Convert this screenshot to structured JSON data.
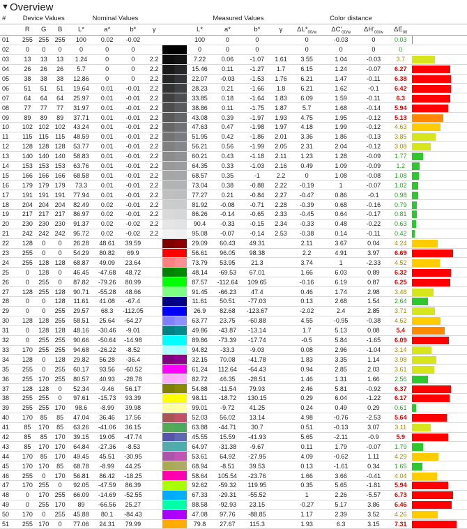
{
  "section_title": "Overview",
  "header1": {
    "num": "#",
    "device": "Device Values",
    "nominal": "Nominal Values",
    "measured": "Measured Values",
    "colordist": "Color distance"
  },
  "header2": [
    "R",
    "G",
    "B",
    "L*",
    "a*",
    "b*",
    "γ",
    "",
    "L*",
    "a*",
    "b*",
    "γ",
    "ΔL*00/w",
    "ΔC'00/w",
    "ΔH'00/w",
    "ΔE00",
    ""
  ],
  "rows": [
    {
      "n": "01",
      "r": 255,
      "g": 255,
      "b": 255,
      "nl": "100",
      "na": "0.02",
      "nb": "-0.02",
      "ng": "",
      "ml": "100",
      "ma": "0",
      "mb": "0",
      "mg": "",
      "dl": "0",
      "dc": "-0.03",
      "dh": "0",
      "de": "0.03",
      "nom": "#ffffff",
      "meas": "#ffffff"
    },
    {
      "n": "02",
      "r": 0,
      "g": 0,
      "b": 0,
      "nl": "0",
      "na": "0",
      "nb": "0",
      "ng": "",
      "ml": "0",
      "ma": "0",
      "mb": "0",
      "mg": "",
      "dl": "0",
      "dc": "0",
      "dh": "0",
      "de": "0",
      "nom": "#000000",
      "meas": "#000000"
    },
    {
      "n": "03",
      "r": 13,
      "g": 13,
      "b": 13,
      "nl": "1.24",
      "na": "0",
      "nb": "0",
      "ng": "2.2",
      "ml": "7.22",
      "ma": "0.06",
      "mb": "-1.07",
      "mg": "1.61",
      "dl": "3.55",
      "dc": "1.04",
      "dh": "-0.03",
      "de": "3.7",
      "nom": "#0d0d0d",
      "meas": "#131314"
    },
    {
      "n": "04",
      "r": 26,
      "g": 26,
      "b": 26,
      "nl": "5.7",
      "na": "0",
      "nb": "0",
      "ng": "2.2",
      "ml": "15.46",
      "ma": "0.11",
      "mb": "-1.27",
      "mg": "1.7",
      "dl": "6.15",
      "dc": "1.24",
      "dh": "-0.07",
      "de": "6.27",
      "nom": "#1a1a1a",
      "meas": "#262628"
    },
    {
      "n": "05",
      "r": 38,
      "g": 38,
      "b": 38,
      "nl": "12.86",
      "na": "0",
      "nb": "0",
      "ng": "2.2",
      "ml": "22.07",
      "ma": "-0.03",
      "mb": "-1.53",
      "mg": "1.76",
      "dl": "6.21",
      "dc": "1.47",
      "dh": "-0.11",
      "de": "6.38",
      "nom": "#262626",
      "meas": "#333437"
    },
    {
      "n": "06",
      "r": 51,
      "g": 51,
      "b": 51,
      "nl": "19.64",
      "na": "0.01",
      "nb": "-0.01",
      "ng": "2.2",
      "ml": "28.23",
      "ma": "0.21",
      "mb": "-1.66",
      "mg": "1.8",
      "dl": "6.21",
      "dc": "1.62",
      "dh": "-0.1",
      "de": "6.42",
      "nom": "#333333",
      "meas": "#404145"
    },
    {
      "n": "07",
      "r": 64,
      "g": 64,
      "b": 64,
      "nl": "25.97",
      "na": "0.01",
      "nb": "-0.01",
      "ng": "2.2",
      "ml": "33.85",
      "ma": "0.18",
      "mb": "-1.64",
      "mg": "1.83",
      "dl": "6.09",
      "dc": "1.59",
      "dh": "-0.11",
      "de": "6.3",
      "nom": "#404040",
      "meas": "#4d4e52"
    },
    {
      "n": "08",
      "r": 77,
      "g": 77,
      "b": 77,
      "nl": "31.97",
      "na": "0.01",
      "nb": "-0.01",
      "ng": "2.2",
      "ml": "38.86",
      "ma": "0.11",
      "mb": "-1.75",
      "mg": "1.87",
      "dl": "5.7",
      "dc": "1.68",
      "dh": "-0.14",
      "de": "5.94",
      "nom": "#4d4d4d",
      "meas": "#5a5b5f"
    },
    {
      "n": "09",
      "r": 89,
      "g": 89,
      "b": 89,
      "nl": "37.71",
      "na": "0.01",
      "nb": "-0.01",
      "ng": "2.2",
      "ml": "43.08",
      "ma": "0.39",
      "mb": "-1.97",
      "mg": "1.93",
      "dl": "4.75",
      "dc": "1.95",
      "dh": "-0.12",
      "de": "5.13",
      "nom": "#595959",
      "meas": "#65666b"
    },
    {
      "n": "10",
      "r": 102,
      "g": 102,
      "b": 102,
      "nl": "43.24",
      "na": "0.01",
      "nb": "-0.01",
      "ng": "2.2",
      "ml": "47.63",
      "ma": "0.47",
      "mb": "-1.98",
      "mg": "1.97",
      "dl": "4.18",
      "dc": "1.99",
      "dh": "-0.12",
      "de": "4.63",
      "nom": "#666666",
      "meas": "#717277"
    },
    {
      "n": "11",
      "r": 115,
      "g": 115,
      "b": 115,
      "nl": "48.59",
      "na": "0.01",
      "nb": "-0.01",
      "ng": "2.2",
      "ml": "51.95",
      "ma": "0.42",
      "mb": "-1.86",
      "mg": "2.01",
      "dl": "3.36",
      "dc": "1.86",
      "dh": "-0.13",
      "de": "3.85",
      "nom": "#737373",
      "meas": "#7b7c81"
    },
    {
      "n": "12",
      "r": 128,
      "g": 128,
      "b": 128,
      "nl": "53.77",
      "na": "0.01",
      "nb": "-0.01",
      "ng": "2.2",
      "ml": "56.21",
      "ma": "0.56",
      "mb": "-1.99",
      "mg": "2.05",
      "dl": "2.31",
      "dc": "2.04",
      "dh": "-0.12",
      "de": "3.08",
      "nom": "#808080",
      "meas": "#86878c"
    },
    {
      "n": "13",
      "r": 140,
      "g": 140,
      "b": 140,
      "nl": "58.83",
      "na": "0.01",
      "nb": "-0.01",
      "ng": "2.2",
      "ml": "60.21",
      "ma": "0.43",
      "mb": "-1.18",
      "mg": "2.11",
      "dl": "1.23",
      "dc": "1.28",
      "dh": "-0.09",
      "de": "1.77",
      "nom": "#8c8c8c",
      "meas": "#909194"
    },
    {
      "n": "14",
      "r": 153,
      "g": 153,
      "b": 153,
      "nl": "63.76",
      "na": "0.01",
      "nb": "-0.01",
      "ng": "2.2",
      "ml": "64.35",
      "ma": "0.33",
      "mb": "-1.03",
      "mg": "2.16",
      "dl": "0.49",
      "dc": "1.09",
      "dh": "-0.09",
      "de": "1.2",
      "nom": "#999999",
      "meas": "#9b9c9f"
    },
    {
      "n": "15",
      "r": 166,
      "g": 166,
      "b": 166,
      "nl": "68.58",
      "na": "0.01",
      "nb": "-0.01",
      "ng": "2.2",
      "ml": "68.57",
      "ma": "0.35",
      "mb": "-1",
      "mg": "2.2",
      "dl": "0",
      "dc": "1.08",
      "dh": "-0.08",
      "de": "1.08",
      "nom": "#a6a6a6",
      "meas": "#a6a7aa"
    },
    {
      "n": "16",
      "r": 179,
      "g": 179,
      "b": 179,
      "nl": "73.3",
      "na": "0.01",
      "nb": "-0.01",
      "ng": "2.2",
      "ml": "73.04",
      "ma": "0.38",
      "mb": "-0.88",
      "mg": "2.22",
      "dl": "-0.19",
      "dc": "1",
      "dh": "-0.07",
      "de": "1.02",
      "nom": "#b3b3b3",
      "meas": "#b2b3b6"
    },
    {
      "n": "17",
      "r": 191,
      "g": 191,
      "b": 191,
      "nl": "77.94",
      "na": "0.01",
      "nb": "-0.01",
      "ng": "2.2",
      "ml": "77.27",
      "ma": "0.21",
      "mb": "-0.84",
      "mg": "2.27",
      "dl": "-0.47",
      "dc": "0.86",
      "dh": "-0.1",
      "de": "0.98",
      "nom": "#bfbfbf",
      "meas": "#bdbec0"
    },
    {
      "n": "18",
      "r": 204,
      "g": 204,
      "b": 204,
      "nl": "82.49",
      "na": "0.02",
      "nb": "-0.01",
      "ng": "2.2",
      "ml": "81.92",
      "ma": "-0.08",
      "mb": "-0.71",
      "mg": "2.28",
      "dl": "-0.39",
      "dc": "0.68",
      "dh": "-0.16",
      "de": "0.79",
      "nom": "#cccccc",
      "meas": "#cacbcd"
    },
    {
      "n": "19",
      "r": 217,
      "g": 217,
      "b": 217,
      "nl": "86.97",
      "na": "0.02",
      "nb": "-0.01",
      "ng": "2.2",
      "ml": "86.26",
      "ma": "-0.14",
      "mb": "-0.65",
      "mg": "2.33",
      "dl": "-0.45",
      "dc": "0.64",
      "dh": "-0.17",
      "de": "0.81",
      "nom": "#d9d9d9",
      "meas": "#d6d7d9"
    },
    {
      "n": "20",
      "r": 230,
      "g": 230,
      "b": 230,
      "nl": "91.37",
      "na": "0.02",
      "nb": "-0.02",
      "ng": "2.2",
      "ml": "90.4",
      "ma": "-0.33",
      "mb": "-0.15",
      "mg": "2.34",
      "dl": "-0.33",
      "dc": "0.48",
      "dh": "-0.22",
      "de": "0.63",
      "nom": "#e6e6e6",
      "meas": "#e2e3e4"
    },
    {
      "n": "21",
      "r": 242,
      "g": 242,
      "b": 242,
      "nl": "95.72",
      "na": "0.02",
      "nb": "-0.02",
      "ng": "2.2",
      "ml": "95.08",
      "ma": "-0.07",
      "mb": "-0.14",
      "mg": "2.53",
      "dl": "-0.38",
      "dc": "0.14",
      "dh": "-0.11",
      "de": "0.42",
      "nom": "#f2f2f2",
      "meas": "#f0f0f0"
    },
    {
      "n": "22",
      "r": 128,
      "g": 0,
      "b": 0,
      "nl": "26.28",
      "na": "48.61",
      "nb": "39.59",
      "ng": "",
      "ml": "29.09",
      "ma": "60.43",
      "mb": "49.31",
      "mg": "",
      "dl": "2.11",
      "dc": "3.67",
      "dh": "0.04",
      "de": "4.24",
      "nom": "#800000",
      "meas": "#8e0000"
    },
    {
      "n": "23",
      "r": 255,
      "g": 0,
      "b": 0,
      "nl": "54.29",
      "na": "80.82",
      "nb": "69.9",
      "ng": "",
      "ml": "56.61",
      "ma": "96.05",
      "mb": "98.38",
      "mg": "",
      "dl": "2.2",
      "dc": "4.91",
      "dh": "3.97",
      "de": "6.69",
      "nom": "#ff0000",
      "meas": "#ff0000"
    },
    {
      "n": "24",
      "r": 255,
      "g": 128,
      "b": 128,
      "nl": "68.87",
      "na": "49.09",
      "nb": "23.64",
      "ng": "",
      "ml": "73.79",
      "ma": "53.95",
      "mb": "21.3",
      "mg": "",
      "dl": "3.74",
      "dc": "1",
      "dh": "-2.33",
      "de": "4.52",
      "nom": "#ff8080",
      "meas": "#ff8f92"
    },
    {
      "n": "25",
      "r": 0,
      "g": 128,
      "b": 0,
      "nl": "46.45",
      "na": "-47.68",
      "nb": "48.72",
      "ng": "",
      "ml": "48.14",
      "ma": "-69.53",
      "mb": "67.01",
      "mg": "",
      "dl": "1.66",
      "dc": "6.03",
      "dh": "0.89",
      "de": "6.32",
      "nom": "#008000",
      "meas": "#008a00"
    },
    {
      "n": "26",
      "r": 0,
      "g": 255,
      "b": 0,
      "nl": "87.82",
      "na": "-79.26",
      "nb": "80.99",
      "ng": "",
      "ml": "87.57",
      "ma": "-112.64",
      "mb": "109.65",
      "mg": "",
      "dl": "-0.16",
      "dc": "6.19",
      "dh": "0.87",
      "de": "6.25",
      "nom": "#00ff00",
      "meas": "#00ff00"
    },
    {
      "n": "27",
      "r": 128,
      "g": 255,
      "b": 128,
      "nl": "90.71",
      "na": "-55.28",
      "nb": "48.66",
      "ng": "",
      "ml": "91.45",
      "ma": "-66.23",
      "mb": "47.4",
      "mg": "",
      "dl": "0.46",
      "dc": "1.74",
      "dh": "2.98",
      "de": "3.48",
      "nom": "#80ff80",
      "meas": "#7cff87"
    },
    {
      "n": "28",
      "r": 0,
      "g": 0,
      "b": 128,
      "nl": "11.61",
      "na": "41.08",
      "nb": "-67.4",
      "ng": "",
      "ml": "11.61",
      "ma": "50.51",
      "mb": "-77.03",
      "mg": "",
      "dl": "0.13",
      "dc": "2.68",
      "dh": "1.54",
      "de": "2.64",
      "nom": "#000080",
      "meas": "#00008a"
    },
    {
      "n": "29",
      "r": 0,
      "g": 0,
      "b": 255,
      "nl": "29.57",
      "na": "68.3",
      "nb": "-112.05",
      "ng": "",
      "ml": "26.9",
      "ma": "82.68",
      "mb": "-123.67",
      "mg": "",
      "dl": "-2.02",
      "dc": "2.4",
      "dh": "2.85",
      "de": "3.71",
      "nom": "#0000ff",
      "meas": "#0000f5"
    },
    {
      "n": "30",
      "r": 128,
      "g": 128,
      "b": 255,
      "nl": "58.51",
      "na": "25.64",
      "nb": "-64.27",
      "ng": "",
      "ml": "63.77",
      "ma": "23.75",
      "mb": "-60.88",
      "mg": "",
      "dl": "4.55",
      "dc": "-0.95",
      "dh": "-0.38",
      "de": "4.62",
      "nom": "#8080ff",
      "meas": "#8d91ff"
    },
    {
      "n": "31",
      "r": 0,
      "g": 128,
      "b": 128,
      "nl": "48.16",
      "na": "-30.46",
      "nb": "-9.01",
      "ng": "",
      "ml": "49.86",
      "ma": "-43.87",
      "mb": "-13.14",
      "mg": "",
      "dl": "1.7",
      "dc": "5.13",
      "dh": "0.08",
      "de": "5.4",
      "nom": "#008080",
      "meas": "#008b8d"
    },
    {
      "n": "32",
      "r": 0,
      "g": 255,
      "b": 255,
      "nl": "90.66",
      "na": "-50.64",
      "nb": "-14.98",
      "ng": "",
      "ml": "89.86",
      "ma": "-73.39",
      "mb": "-17.74",
      "mg": "",
      "dl": "-0.5",
      "dc": "5.84",
      "dh": "-1.65",
      "de": "6.09",
      "nom": "#00ffff",
      "meas": "#00ffff"
    },
    {
      "n": "33",
      "r": 170,
      "g": 255,
      "b": 255,
      "nl": "94.68",
      "na": "-26.22",
      "nb": "-8.52",
      "ng": "",
      "ml": "94.82",
      "ma": "-33.3",
      "mb": "-9.03",
      "mg": "",
      "dl": "0.08",
      "dc": "2.96",
      "dh": "-1.04",
      "de": "3.14",
      "nom": "#aaffff",
      "meas": "#a5ffff"
    },
    {
      "n": "34",
      "r": 128,
      "g": 0,
      "b": 128,
      "nl": "29.82",
      "na": "56.28",
      "nb": "-36.4",
      "ng": "",
      "ml": "32.15",
      "ma": "70.08",
      "mb": "-41.78",
      "mg": "",
      "dl": "1.83",
      "dc": "3.35",
      "dh": "1.14",
      "de": "3.98",
      "nom": "#800080",
      "meas": "#8f008f"
    },
    {
      "n": "35",
      "r": 255,
      "g": 0,
      "b": 255,
      "nl": "60.17",
      "na": "93.56",
      "nb": "-60.52",
      "ng": "",
      "ml": "61.24",
      "ma": "112.64",
      "mb": "-64.43",
      "mg": "",
      "dl": "0.94",
      "dc": "2.85",
      "dh": "2.03",
      "de": "3.61",
      "nom": "#ff00ff",
      "meas": "#ff00ff"
    },
    {
      "n": "36",
      "r": 255,
      "g": 170,
      "b": 255,
      "nl": "80.57",
      "na": "40.93",
      "nb": "-28.78",
      "ng": "",
      "ml": "82.72",
      "ma": "46.35",
      "mb": "-28.51",
      "mg": "",
      "dl": "1.46",
      "dc": "1.31",
      "dh": "1.66",
      "de": "2.56",
      "nom": "#ffaaff",
      "meas": "#ffb0ff"
    },
    {
      "n": "37",
      "r": 128,
      "g": 128,
      "b": 0,
      "nl": "52.34",
      "na": "-9.46",
      "nb": "56.17",
      "ng": "",
      "ml": "54.88",
      "ma": "-11.54",
      "mb": "79.93",
      "mg": "",
      "dl": "2.46",
      "dc": "5.81",
      "dh": "-0.92",
      "de": "6.37",
      "nom": "#808000",
      "meas": "#8a8a00"
    },
    {
      "n": "38",
      "r": 255,
      "g": 255,
      "b": 0,
      "nl": "97.61",
      "na": "-15.73",
      "nb": "93.39",
      "ng": "",
      "ml": "98.11",
      "ma": "-18.72",
      "mb": "130.15",
      "mg": "",
      "dl": "0.29",
      "dc": "6.04",
      "dh": "-1.22",
      "de": "6.17",
      "nom": "#ffff00",
      "meas": "#ffff00"
    },
    {
      "n": "39",
      "r": 255,
      "g": 255,
      "b": 170,
      "nl": "98.6",
      "na": "-8.99",
      "nb": "39.98",
      "ng": "",
      "ml": "99.01",
      "ma": "-9.72",
      "mb": "41.25",
      "mg": "",
      "dl": "0.24",
      "dc": "0.49",
      "dh": "0.29",
      "de": "0.61",
      "nom": "#ffffaa",
      "meas": "#ffffa8"
    },
    {
      "n": "40",
      "r": 170,
      "g": 85,
      "b": 85,
      "nl": "47.04",
      "na": "36.46",
      "nb": "17.56",
      "ng": "",
      "ml": "52.03",
      "ma": "56.02",
      "mb": "13.14",
      "mg": "",
      "dl": "4.98",
      "dc": "-0.76",
      "dh": "-2.53",
      "de": "5.64",
      "nom": "#aa5555",
      "meas": "#c25066"
    },
    {
      "n": "41",
      "r": 85,
      "g": 170,
      "b": 85,
      "nl": "63.26",
      "na": "-41.06",
      "nb": "36.15",
      "ng": "",
      "ml": "63.88",
      "ma": "-44.71",
      "mb": "30.7",
      "mg": "",
      "dl": "0.51",
      "dc": "-0.13",
      "dh": "3.07",
      "de": "3.11",
      "nom": "#55aa55",
      "meas": "#4aab5e"
    },
    {
      "n": "42",
      "r": 85,
      "g": 85,
      "b": 170,
      "nl": "39.15",
      "na": "19.05",
      "nb": "-47.74",
      "ng": "",
      "ml": "45.55",
      "ma": "15.59",
      "mb": "-41.93",
      "mg": "",
      "dl": "5.65",
      "dc": "-2.11",
      "dh": "-0.9",
      "de": "5.9",
      "nom": "#5555aa",
      "meas": "#5f68b2"
    },
    {
      "n": "43",
      "r": 85,
      "g": 170,
      "b": 170,
      "nl": "64.84",
      "na": "-27.36",
      "nb": "-8.53",
      "ng": "",
      "ml": "64.97",
      "ma": "-31.38",
      "mb": "-9.67",
      "mg": "",
      "dl": "0.11",
      "dc": "1.79",
      "dh": "-0.07",
      "de": "1.79",
      "nom": "#55aaaa",
      "meas": "#4dadad"
    },
    {
      "n": "44",
      "r": 170,
      "g": 85,
      "b": 170,
      "nl": "49.45",
      "na": "45.51",
      "nb": "-30.95",
      "ng": "",
      "ml": "53.61",
      "ma": "64.92",
      "mb": "-27.95",
      "mg": "",
      "dl": "4.09",
      "dc": "-0.62",
      "dh": "1.11",
      "de": "4.29",
      "nom": "#aa55aa",
      "meas": "#c255b4"
    },
    {
      "n": "45",
      "r": 170,
      "g": 170,
      "b": 85,
      "nl": "68.78",
      "na": "-8.99",
      "nb": "44.25",
      "ng": "",
      "ml": "68.94",
      "ma": "-8.51",
      "mb": "39.53",
      "mg": "",
      "dl": "0.13",
      "dc": "-1.61",
      "dh": "0.34",
      "de": "1.65",
      "nom": "#aaaa55",
      "meas": "#adab62"
    },
    {
      "n": "46",
      "r": 255,
      "g": 0,
      "b": 170,
      "nl": "56.81",
      "na": "86.42",
      "nb": "-18.25",
      "ng": "",
      "ml": "58.64",
      "ma": "105.54",
      "mb": "-23.76",
      "mg": "",
      "dl": "1.66",
      "dc": "3.66",
      "dh": "-0.41",
      "de": "4.04",
      "nom": "#ff00aa",
      "meas": "#ff00b2"
    },
    {
      "n": "47",
      "r": 170,
      "g": 255,
      "b": 0,
      "nl": "92.05",
      "na": "-47.59",
      "nb": "86.39",
      "ng": "",
      "ml": "92.62",
      "ma": "-59.32",
      "mb": "119.95",
      "mg": "",
      "dl": "0.35",
      "dc": "5.65",
      "dh": "-1.81",
      "de": "5.94",
      "nom": "#aaff00",
      "meas": "#a8ff00"
    },
    {
      "n": "48",
      "r": 0,
      "g": 170,
      "b": 255,
      "nl": "66.09",
      "na": "-14.69",
      "nb": "-52.55",
      "ng": "",
      "ml": "67.33",
      "ma": "-29.31",
      "mb": "-55.52",
      "mg": "",
      "dl": "1",
      "dc": "2.26",
      "dh": "-5.57",
      "de": "6.73",
      "nom": "#00aaff",
      "meas": "#00b0ff"
    },
    {
      "n": "49",
      "r": 0,
      "g": 255,
      "b": 170,
      "nl": "89",
      "na": "-66.56",
      "nb": "25.27",
      "ng": "",
      "ml": "88.58",
      "ma": "-92.93",
      "mb": "23.15",
      "mg": "",
      "dl": "-0.27",
      "dc": "5.17",
      "dh": "3.86",
      "de": "6.46",
      "nom": "#00ffaa",
      "meas": "#00ffa4"
    },
    {
      "n": "50",
      "r": 170,
      "g": 0,
      "b": 255,
      "nl": "45.88",
      "na": "80.1",
      "nb": "-84.43",
      "ng": "",
      "ml": "47.08",
      "ma": "97.76",
      "mb": "-88.85",
      "mg": "",
      "dl": "1.17",
      "dc": "2.39",
      "dh": "3.52",
      "de": "4.26",
      "nom": "#aa00ff",
      "meas": "#b000ff"
    },
    {
      "n": "51",
      "r": 255,
      "g": 170,
      "b": 0,
      "nl": "77.06",
      "na": "24.31",
      "nb": "79.99",
      "ng": "",
      "ml": "79.8",
      "ma": "27.67",
      "mb": "115.3",
      "mg": "",
      "dl": "1.93",
      "dc": "6.3",
      "dh": "3.15",
      "de": "7.31",
      "nom": "#ffaa00",
      "meas": "#ffae00"
    }
  ]
}
